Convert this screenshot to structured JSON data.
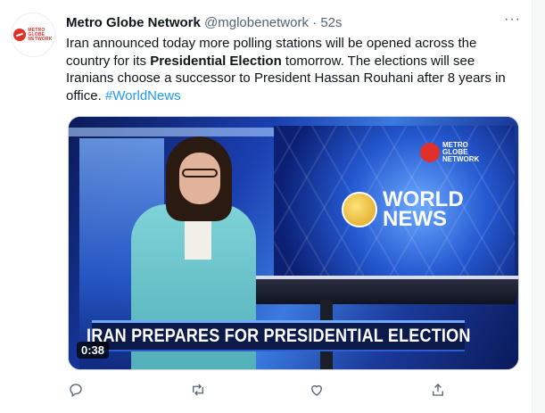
{
  "tweet": {
    "author_name": "Metro Globe Network",
    "handle": "@mglobenetwork",
    "separator": "·",
    "time": "52s",
    "more_label": "···",
    "text_part1": "Iran announced today more polling stations will be opened across the country for its ",
    "text_bold": "Presidential Election",
    "text_part2": " tomorrow. The elections will see Iranians choose a successor to President Hassan Rouhani after 8 years in office. ",
    "hashtag": "#WorldNews"
  },
  "avatar": {
    "logo_text_line1": "METRO",
    "logo_text_line2": "GLOBE",
    "logo_text_line3": "NETWORK"
  },
  "media": {
    "corner_logo_line1": "METRO",
    "corner_logo_line2": "GLOBE",
    "corner_logo_line3": "NETWORK",
    "world_news_line1": "WORLD",
    "world_news_line2": "NEWS",
    "ticker_text": "IRAN PREPARES FOR PRESIDENTIAL ELECTION",
    "duration": "0:38"
  },
  "actions": [
    {
      "icon": "reply-icon"
    },
    {
      "icon": "retweet-icon"
    },
    {
      "icon": "like-icon"
    },
    {
      "icon": "share-icon"
    }
  ],
  "colors": {
    "link": "#1d9bf0",
    "secondary_text": "#536471",
    "brand_red": "#e0302a"
  }
}
